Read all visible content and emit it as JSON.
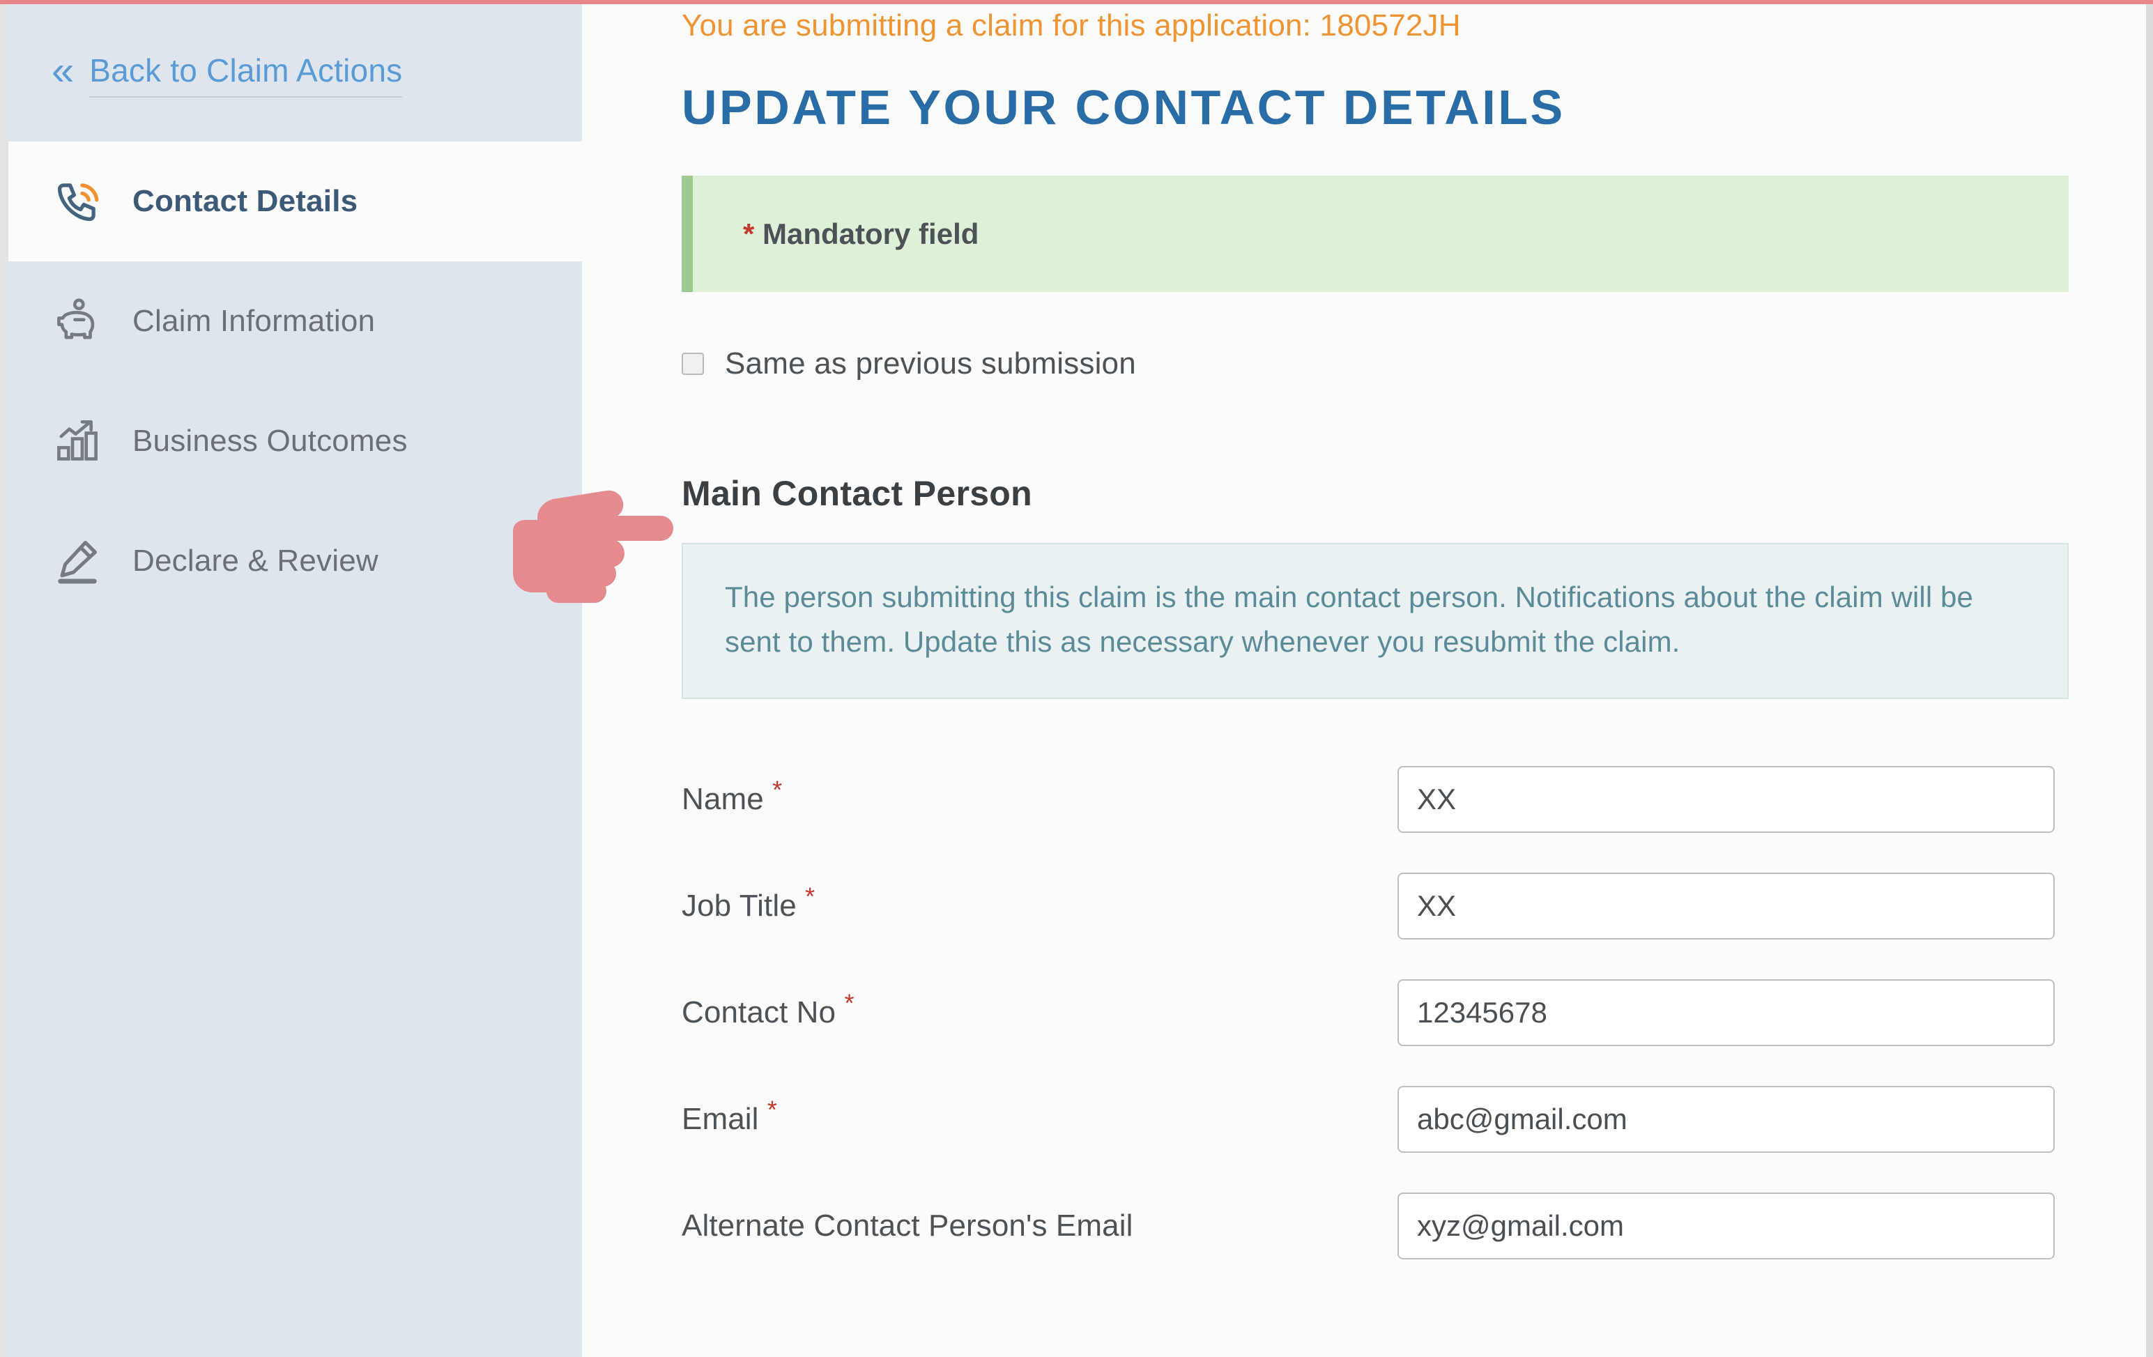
{
  "sidebar": {
    "back_link": {
      "label": "Back to Claim Actions",
      "chevron": "«"
    },
    "items": [
      {
        "label": "Contact Details",
        "icon": "phone-icon",
        "active": true
      },
      {
        "label": "Claim Information",
        "icon": "piggy-bank-icon",
        "active": false
      },
      {
        "label": "Business Outcomes",
        "icon": "bar-chart-icon",
        "active": false
      },
      {
        "label": "Declare & Review",
        "icon": "pen-icon",
        "active": false
      }
    ]
  },
  "main": {
    "claim_notice": "You are submitting a claim for this application: 180572JH",
    "page_title": "UPDATE YOUR CONTACT DETAILS",
    "mandatory_banner": {
      "star": "*",
      "text": "Mandatory field"
    },
    "same_as_previous": {
      "label": "Same as previous submission",
      "checked": false
    },
    "section_heading": "Main Contact Person",
    "info_text": "The person submitting this claim is the main contact person. Notifications about the claim will be sent to them. Update this as necessary whenever you resubmit the claim.",
    "fields": [
      {
        "label": "Name",
        "required": true,
        "value": "XX"
      },
      {
        "label": "Job Title",
        "required": true,
        "value": "XX"
      },
      {
        "label": "Contact No",
        "required": true,
        "value": "12345678"
      },
      {
        "label": "Email",
        "required": true,
        "value": "abc@gmail.com"
      },
      {
        "label": "Alternate Contact Person's Email",
        "required": false,
        "value": "xyz@gmail.com"
      }
    ]
  },
  "pointer": {
    "icon": "pointing-hand-left-icon",
    "color": "#e38b8d"
  },
  "colors": {
    "accent_blue": "#2a6ca6",
    "link_blue": "#5b9bd5",
    "orange": "#ef9432",
    "sidebar_bg": "#dfe5ec",
    "banner_green": "#dff0d8",
    "info_blue": "#e9f1f2",
    "required_red": "#c0392b"
  }
}
